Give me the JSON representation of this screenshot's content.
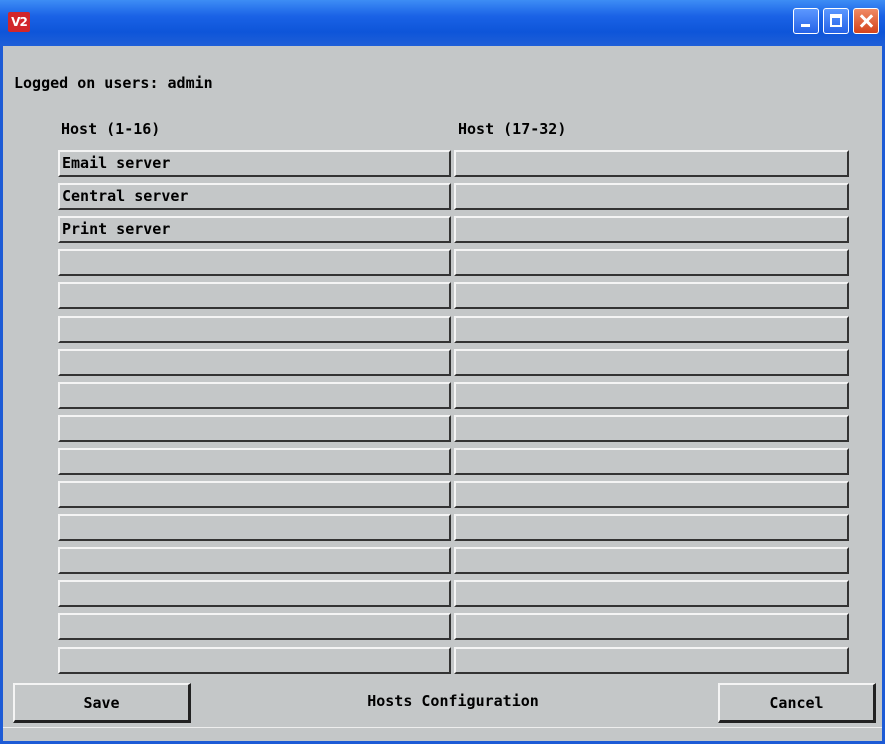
{
  "window": {
    "icon_text": "V2"
  },
  "header": {
    "logged_text": "Logged on users: admin"
  },
  "columns": {
    "left": "Host (1-16)",
    "right": "Host (17-32)"
  },
  "hosts_left": [
    "Email server",
    "Central server",
    "Print server",
    "",
    "",
    "",
    "",
    "",
    "",
    "",
    "",
    "",
    "",
    "",
    "",
    ""
  ],
  "hosts_right": [
    "",
    "",
    "",
    "",
    "",
    "",
    "",
    "",
    "",
    "",
    "",
    "",
    "",
    "",
    "",
    ""
  ],
  "footer": {
    "save_label": "Save",
    "title": "Hosts Configuration",
    "cancel_label": "Cancel"
  },
  "colors": {
    "titlebar": "#1a62e6",
    "window_bg": "#c4c7c8",
    "close_button": "#d4431c"
  }
}
